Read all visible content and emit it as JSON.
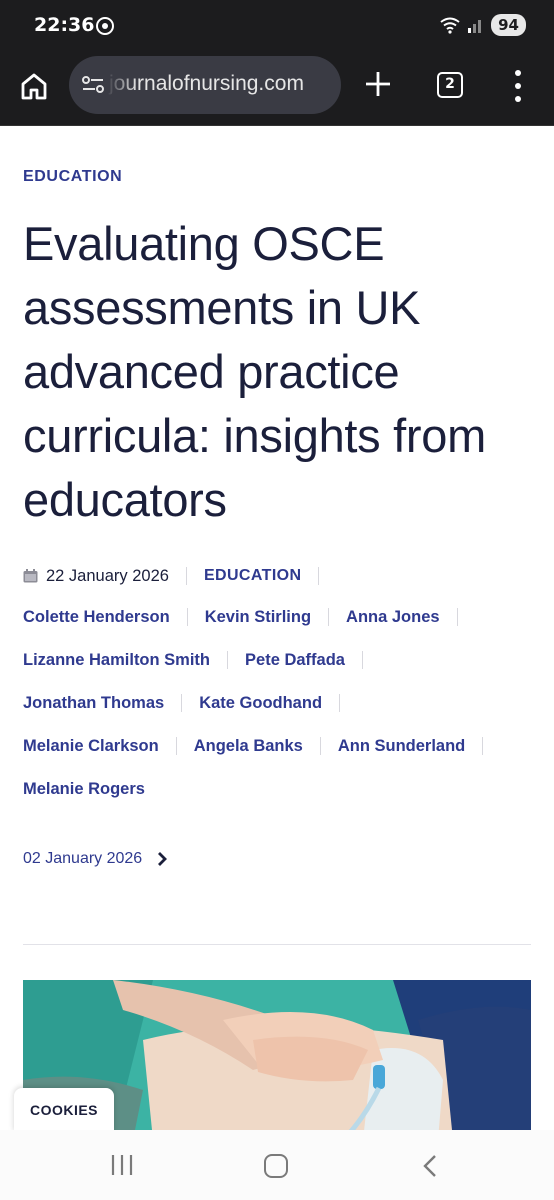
{
  "status_bar": {
    "time": "22:36",
    "battery": "94"
  },
  "browser": {
    "url": "journalofnursing.com",
    "tab_count": "2"
  },
  "article": {
    "category": "EDUCATION",
    "title": "Evaluating OSCE assessments in UK advanced practice curricula: insights from educators",
    "date": "22 January 2026",
    "meta_category": "EDUCATION",
    "authors": [
      "Colette Henderson",
      "Kevin Stirling",
      "Anna Jones",
      "Lizanne Hamilton Smith",
      "Pete Daffada",
      "Jonathan Thomas",
      "Kate Goodhand",
      "Melanie Clarkson",
      "Angela Banks",
      "Ann Sunderland",
      "Melanie Rogers"
    ],
    "previous_issue_date": "02 January 2026"
  },
  "cookies": {
    "label": "COOKIES"
  },
  "colors": {
    "accent": "#2f3a8f",
    "title": "#1b1f3b",
    "chrome_dark": "#1c1c1e"
  },
  "icons": [
    "home-icon",
    "site-info-icon",
    "plus-icon",
    "tabs-icon",
    "more-vert-icon",
    "calendar-icon",
    "chevron-right-icon",
    "recents-icon",
    "home-nav-icon",
    "back-icon"
  ]
}
